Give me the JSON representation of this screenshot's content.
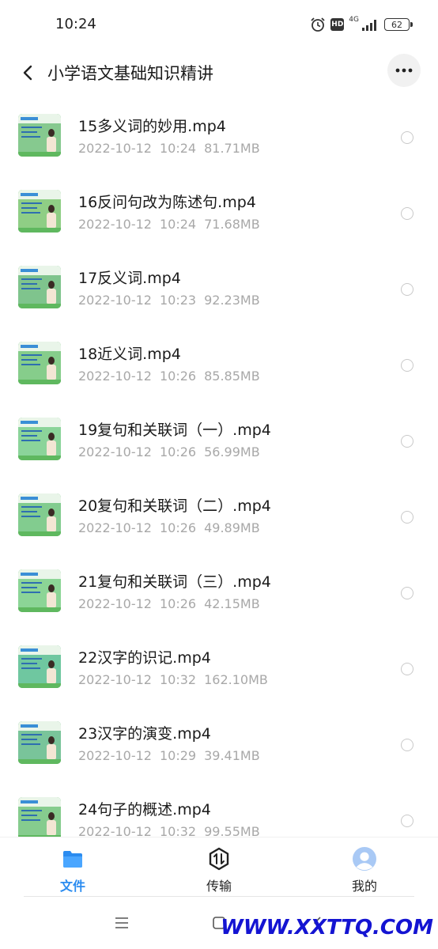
{
  "status_bar": {
    "time": "10:24",
    "hd_badge": "HD",
    "network": "4G",
    "battery": "62"
  },
  "header": {
    "title": "小学语文基础知识精讲"
  },
  "files": [
    {
      "name": "15多义词的妙用.mp4",
      "date": "2022-10-12",
      "time": "10:24",
      "size": "81.71MB",
      "thumb_color": "#86c98f"
    },
    {
      "name": "16反问句改为陈述句.mp4",
      "date": "2022-10-12",
      "time": "10:24",
      "size": "71.68MB",
      "thumb_color": "#8fce85"
    },
    {
      "name": "17反义词.mp4",
      "date": "2022-10-12",
      "time": "10:23",
      "size": "92.23MB",
      "thumb_color": "#7fc48d"
    },
    {
      "name": "18近义词.mp4",
      "date": "2022-10-12",
      "time": "10:26",
      "size": "85.85MB",
      "thumb_color": "#86cd8b"
    },
    {
      "name": "19复句和关联词（一）.mp4",
      "date": "2022-10-12",
      "time": "10:26",
      "size": "56.99MB",
      "thumb_color": "#8bd49a"
    },
    {
      "name": "20复句和关联词（二）.mp4",
      "date": "2022-10-12",
      "time": "10:26",
      "size": "49.89MB",
      "thumb_color": "#82cc8f"
    },
    {
      "name": "21复句和关联词（三）.mp4",
      "date": "2022-10-12",
      "time": "10:26",
      "size": "42.15MB",
      "thumb_color": "#8cd596"
    },
    {
      "name": "22汉字的识记.mp4",
      "date": "2022-10-12",
      "time": "10:32",
      "size": "162.10MB",
      "thumb_color": "#6fc7a0"
    },
    {
      "name": "23汉字的演变.mp4",
      "date": "2022-10-12",
      "time": "10:29",
      "size": "39.41MB",
      "thumb_color": "#79c49a"
    },
    {
      "name": "24句子的概述.mp4",
      "date": "2022-10-12",
      "time": "10:32",
      "size": "99.55MB",
      "thumb_color": "#86cc8e"
    }
  ],
  "tabs": [
    {
      "label": "文件",
      "icon": "folder-icon",
      "active": true
    },
    {
      "label": "传输",
      "icon": "transfer-icon",
      "active": false
    },
    {
      "label": "我的",
      "icon": "avatar-icon",
      "active": false
    }
  ],
  "colors": {
    "accent": "#2b8cf0",
    "meta_text": "#a8a8a8"
  },
  "watermark": "WWW.XXTTQ.COM"
}
